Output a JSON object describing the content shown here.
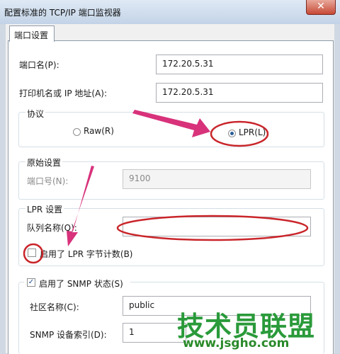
{
  "window": {
    "title": "配置标准的 TCP/IP 端口监视器",
    "close_glyph": "✕"
  },
  "tabs": [
    {
      "label": "端口设置"
    }
  ],
  "port_name": {
    "label": "端口名(P):",
    "value": "172.20.5.31"
  },
  "printer_address": {
    "label": "打印机名或 IP 地址(A):",
    "value": "172.20.5.31"
  },
  "protocol": {
    "legend": "协议",
    "options": [
      {
        "label": "Raw(R)",
        "selected": false
      },
      {
        "label": "LPR(L)",
        "selected": true
      }
    ]
  },
  "raw_settings": {
    "legend": "原始设置",
    "port_label": "端口号(N):",
    "port_value": "9100"
  },
  "lpr_settings": {
    "legend": "LPR 设置",
    "queue_label": "队列名称(Q):",
    "queue_value": "",
    "byte_counting_label": "启用了 LPR 字节计数(B)",
    "byte_counting_checked": false
  },
  "snmp": {
    "enabled_label": "启用了 SNMP 状态(S)",
    "enabled": true,
    "community_label": "社区名称(C):",
    "community_value": "public",
    "index_label": "SNMP 设备索引(D):",
    "index_value": "1"
  },
  "watermark": {
    "text": "技术员联盟",
    "url": "www.jsgho.com"
  },
  "annotation_color": "#d8327b"
}
